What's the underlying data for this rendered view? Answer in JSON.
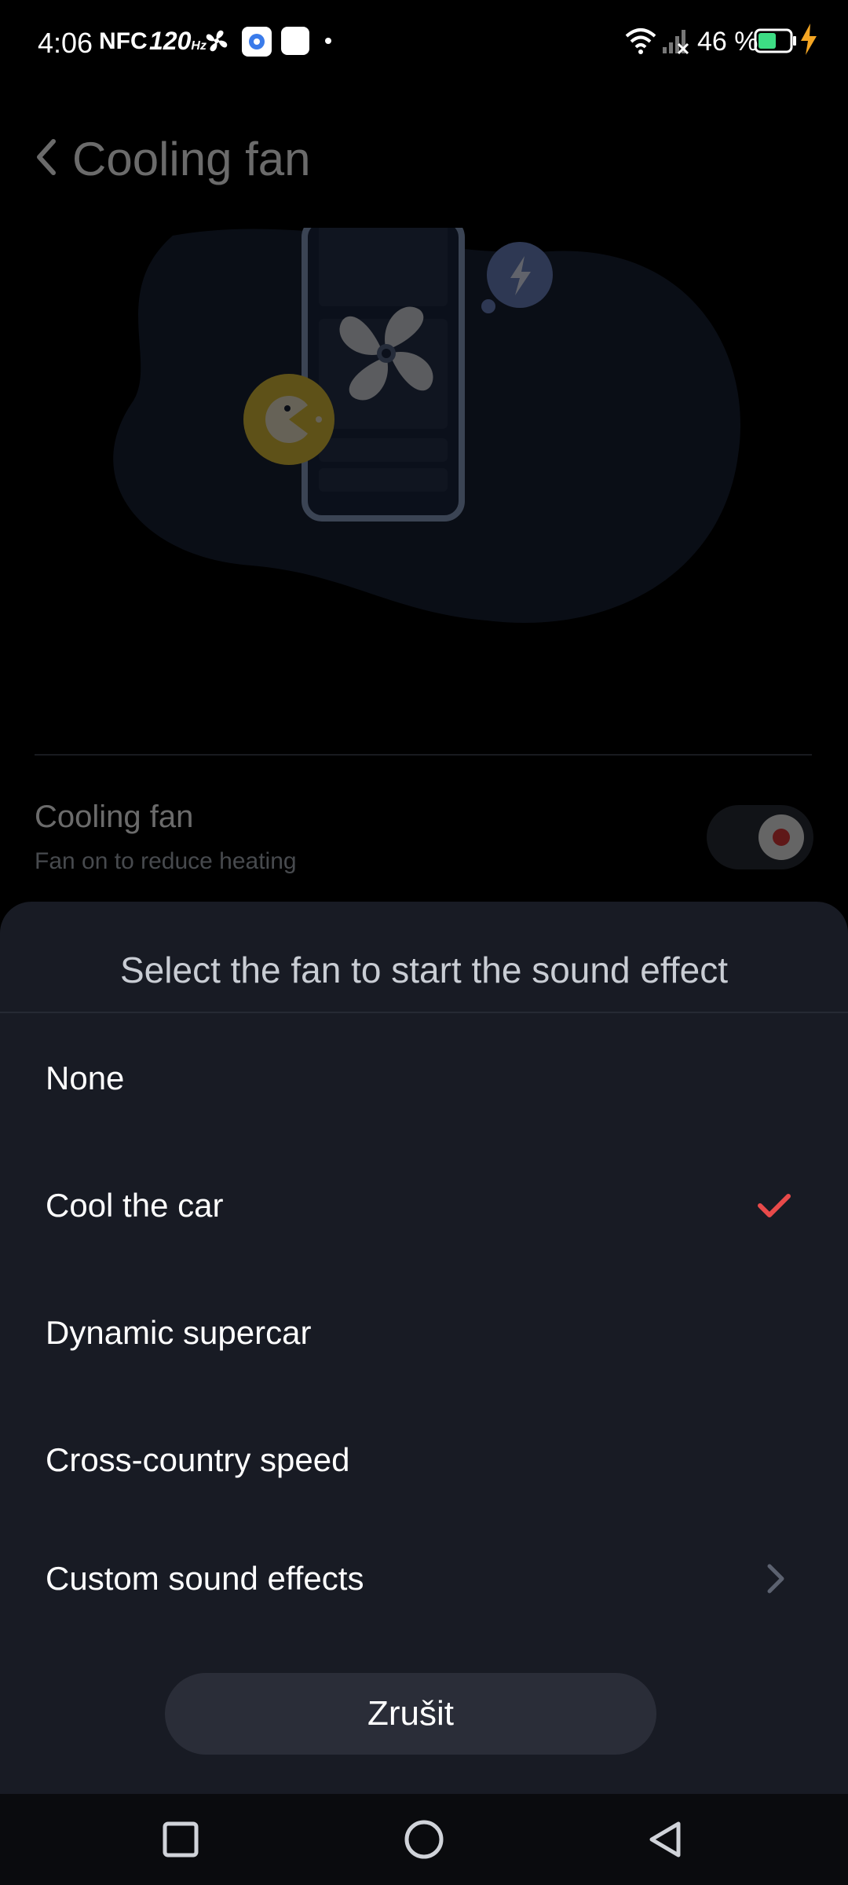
{
  "status_bar": {
    "time": "4:06",
    "nfc": "NFC",
    "refresh_rate": "120",
    "refresh_unit": "Hz",
    "battery": "46 %",
    "icons": [
      "fan-icon",
      "settings-app-icon",
      "white-square-icon",
      "dot-icon",
      "wifi-icon",
      "signal-icon",
      "battery-icon",
      "charging-icon"
    ]
  },
  "header": {
    "back_icon": "back-chevron-icon",
    "title": "Cooling fan"
  },
  "illustration": {
    "icons": [
      "phone-outline",
      "fan-blades-icon",
      "lightning-icon",
      "pacman-game-icon"
    ]
  },
  "setting": {
    "title": "Cooling fan",
    "subtitle": "Fan on to reduce heating",
    "toggle_on": true
  },
  "sheet": {
    "title": "Select the fan to start the sound effect",
    "options": [
      {
        "label": "None",
        "selected": false
      },
      {
        "label": "Cool the car",
        "selected": true
      },
      {
        "label": "Dynamic supercar",
        "selected": false
      },
      {
        "label": "Cross-country speed",
        "selected": false
      },
      {
        "label": "Custom sound effects",
        "selected": false,
        "has_chevron": true
      }
    ],
    "cancel_label": "Zrušit"
  },
  "colors": {
    "accent_check": "#e84a4a",
    "sheet_bg": "#181b24",
    "charging": "#f5a623",
    "battery_fill": "#3ddc84"
  },
  "nav_bar": {
    "icons": [
      "recent-apps-icon",
      "home-icon",
      "back-icon"
    ]
  }
}
